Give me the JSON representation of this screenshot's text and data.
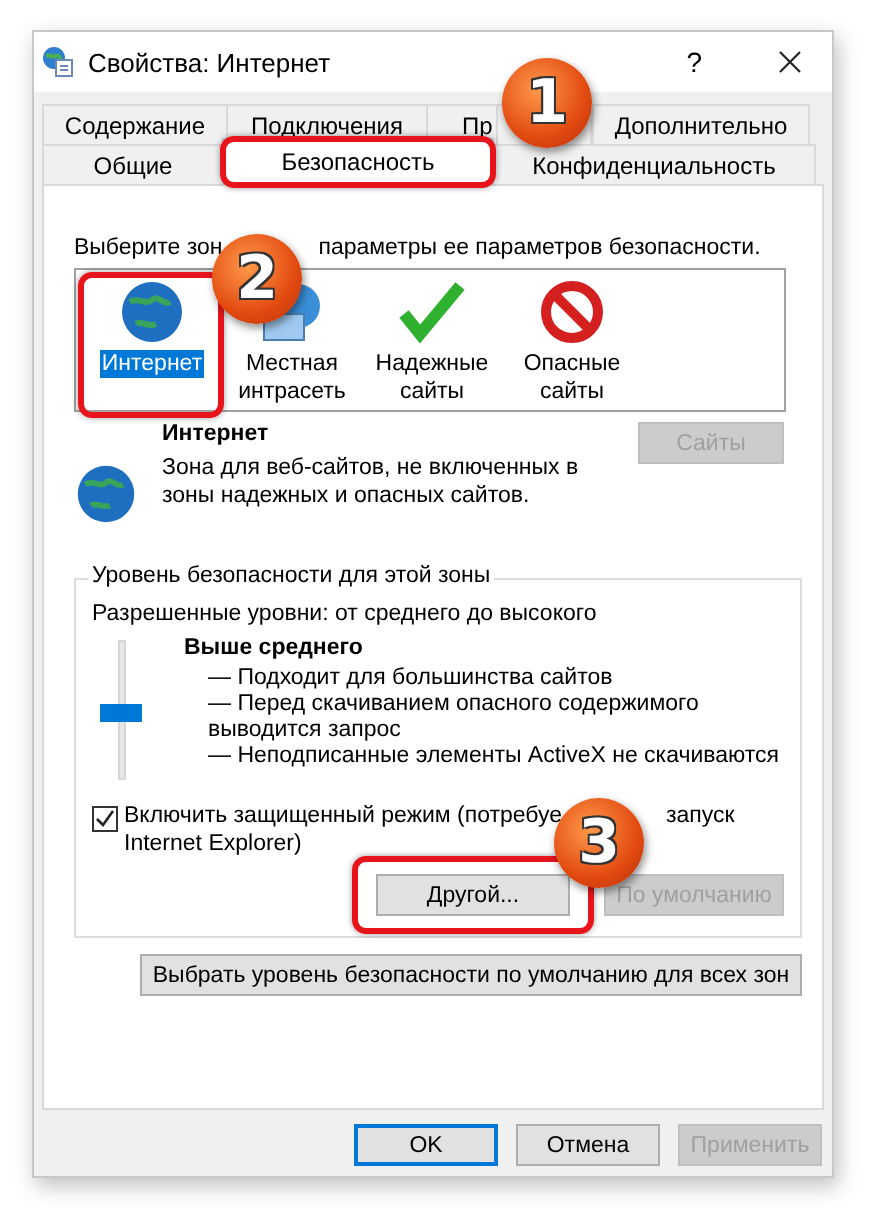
{
  "window": {
    "title": "Свойства: Интернет",
    "help": "?"
  },
  "tab_rows": [
    [
      {
        "label": "Содержание",
        "selected": false
      },
      {
        "label": "Подключения",
        "selected": false
      },
      {
        "label": "Пр",
        "selected": false
      },
      {
        "label": "Дополнительно",
        "selected": false
      }
    ],
    [
      {
        "label": "Общие",
        "selected": false
      },
      {
        "label": "Безопасность",
        "selected": true
      },
      {
        "label": "Конфиденциальность",
        "selected": false
      }
    ]
  ],
  "zone_prompt": [
    "Выберите зон",
    "параметры ее параметров безопасности."
  ],
  "zones": [
    {
      "label": "Интернет",
      "kind": "internet",
      "selected": true
    },
    {
      "label": "Местная интрасеть",
      "kind": "intranet",
      "selected": false
    },
    {
      "label": "Надежные сайты",
      "kind": "trusted",
      "selected": false
    },
    {
      "label": "Опасные сайты",
      "kind": "restricted",
      "selected": false
    }
  ],
  "zone_info": {
    "title": "Интернет",
    "description": "Зона для веб-сайтов, не включенных в зоны надежных и опасных сайтов.",
    "sites_button": {
      "label": "Сайты",
      "disabled": true
    }
  },
  "security_level": {
    "title": "Уровень безопасности для этой зоны",
    "allowed": "Разрешенные уровни: от среднего до высокого",
    "level": 0.5,
    "level_name": "Выше среднего",
    "points": [
      "— Подходит для большинства сайтов",
      "— Перед скачиванием опасного содержимого выводится запрос",
      "— Неподписанные элементы ActiveX не скачиваются"
    ],
    "protected_mode": {
      "label_parts": [
        "Включить защищенный режим (потребуе",
        "запуск"
      ],
      "label_line2": "Internet Explorer)",
      "checked": true
    },
    "buttons": [
      {
        "label": "Другой...",
        "disabled": false
      },
      {
        "label": "По умолчанию",
        "disabled": true
      }
    ]
  },
  "reset_all_button": "Выбрать уровень безопасности по умолчанию для всех зон",
  "footer_buttons": [
    {
      "label": "OK",
      "kind": "default",
      "disabled": false
    },
    {
      "label": "Отмена",
      "kind": "normal",
      "disabled": false
    },
    {
      "label": "Применить",
      "kind": "normal",
      "disabled": true
    }
  ],
  "callouts": [
    {
      "number": "1"
    },
    {
      "number": "2"
    },
    {
      "number": "3"
    }
  ]
}
